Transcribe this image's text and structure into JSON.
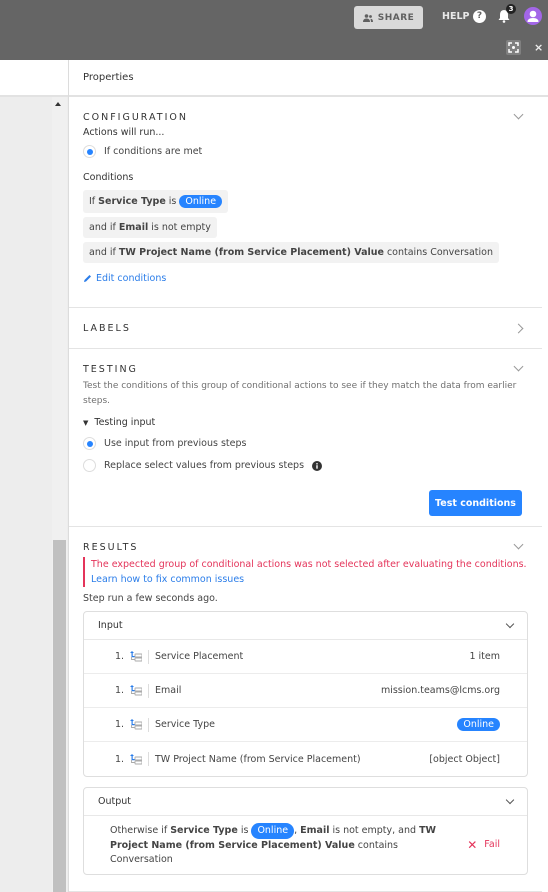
{
  "topbar": {
    "share_label": "SHARE",
    "help_label": "HELP",
    "help_icon": "question-circle-icon",
    "notification_count": "3",
    "close_label": "×"
  },
  "panel": {
    "title": "Properties",
    "configuration": {
      "title": "CONFIGURATION",
      "actions_label": "Actions will run...",
      "run_option": "If conditions are met",
      "conditions_label": "Conditions",
      "conditions": [
        {
          "prefix": "If ",
          "field": "Service Type",
          "op": " is ",
          "pill": "Online",
          "rest": ""
        },
        {
          "prefix": "and if ",
          "field": "Email",
          "op": " is not empty",
          "pill": "",
          "rest": ""
        },
        {
          "prefix": "and if ",
          "field": "TW Project Name (from Service Placement) Value",
          "op": " contains Conversation",
          "pill": "",
          "rest": ""
        }
      ],
      "edit_link": "Edit conditions"
    },
    "labels": {
      "title": "LABELS"
    },
    "testing": {
      "title": "TESTING",
      "description": "Test the conditions of this group of conditional actions to see if they match the data from earlier steps.",
      "input_toggle": "Testing input",
      "options": [
        "Use input from previous steps",
        "Replace select values from previous steps"
      ],
      "selected_option": 0,
      "button": "Test conditions"
    },
    "results": {
      "title": "RESULTS",
      "error": "The expected group of conditional actions was not selected after evaluating the conditions.",
      "help_link": "Learn how to fix common issues",
      "run_time": "Step run a few seconds ago.",
      "input": {
        "title": "Input",
        "rows": [
          {
            "num": "1.",
            "name": "Service Placement",
            "value": "1 item",
            "pill": false
          },
          {
            "num": "1.",
            "name": "Email",
            "value": "mission.teams@lcms.org",
            "pill": false
          },
          {
            "num": "1.",
            "name": "Service Type",
            "value": "Online",
            "pill": true
          },
          {
            "num": "1.",
            "name": "TW Project Name (from Service Placement)",
            "value": "[object Object]",
            "pill": false
          }
        ]
      },
      "output": {
        "title": "Output",
        "text_a": "Otherwise if ",
        "field_a": "Service Type",
        "text_b": " is ",
        "pill": "Online",
        "text_c": ", ",
        "field_b": "Email",
        "text_d": " is not empty, and ",
        "field_c": "TW Project Name (from Service Placement) Value",
        "text_e": " contains Conversation",
        "status": "Fail"
      }
    }
  },
  "colors": {
    "accent": "#2684ff",
    "error": "#e4345a",
    "topbar": "#656565",
    "avatar": "#a366e8"
  }
}
